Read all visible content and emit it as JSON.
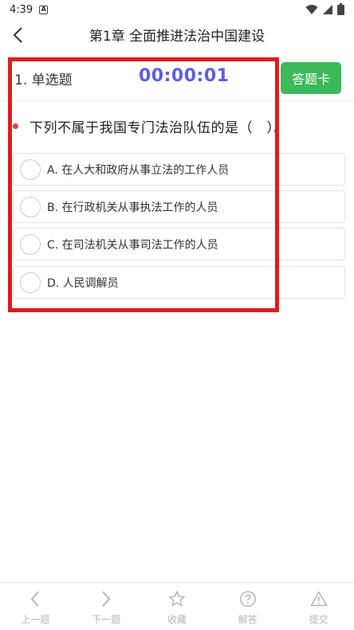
{
  "status_bar": {
    "time": "4:39",
    "notification_icon": "A"
  },
  "header": {
    "title": "第1章 全面推进法治中国建设"
  },
  "question": {
    "type_label": "1. 单选题",
    "timer": "00:00:01",
    "answer_sheet_label": "答题卡",
    "stem": "下列不属于我国专门法治队伍的是（　）。",
    "options": [
      {
        "label": "A. 在人大和政府从事立法的工作人员"
      },
      {
        "label": "B. 在行政机关从事执法工作的人员"
      },
      {
        "label": "C. 在司法机关从事司法工作的人员"
      },
      {
        "label": "D. 人民调解员"
      }
    ]
  },
  "bottom_bar": {
    "items": [
      {
        "label": "上一题",
        "icon": "chevron-left-icon"
      },
      {
        "label": "下一题",
        "icon": "chevron-right-icon"
      },
      {
        "label": "收藏",
        "icon": "star-icon"
      },
      {
        "label": "解答",
        "icon": "question-circle-icon"
      },
      {
        "label": "提交",
        "icon": "warning-triangle-icon"
      }
    ]
  },
  "colors": {
    "timer": "#5b5fe0",
    "answer_sheet_button": "#3cb95a",
    "stem_dot": "#e53c3c",
    "highlight_box": "#e11b1b"
  }
}
